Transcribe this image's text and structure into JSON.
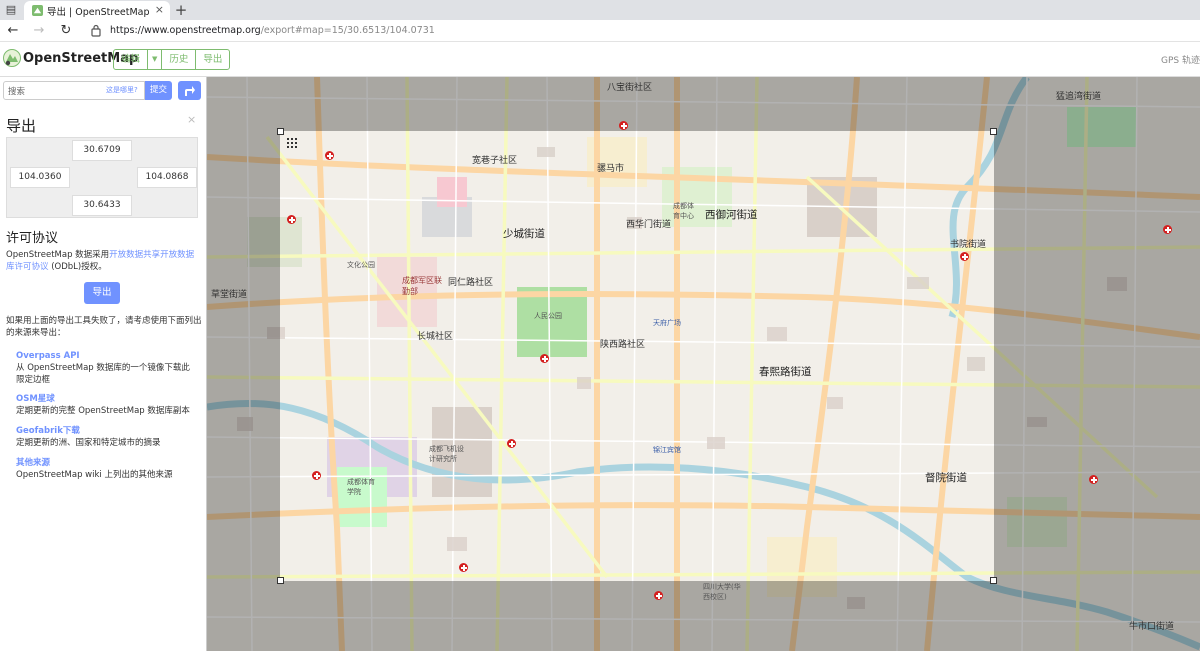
{
  "browser": {
    "tab_title": "导出 | OpenStreetMap",
    "url_host": "https://www.openstreetmap.org",
    "url_path": "/export#map=15/30.6513/104.0731"
  },
  "header": {
    "logo_text": "OpenStreetMap",
    "edit_label": "编辑",
    "history_label": "历史",
    "export_label": "导出",
    "gps_label": "GPS 轨迹"
  },
  "search": {
    "placeholder": "搜索",
    "hint": "这是哪里?",
    "submit_label": "提交"
  },
  "export_panel": {
    "title": "导出",
    "close": "×",
    "bbox": {
      "north": "30.6709",
      "west": "104.0360",
      "east": "104.0868",
      "south": "30.6433"
    },
    "license_title": "许可协议",
    "license_prefix": "OpenStreetMap 数据采用",
    "license_link": "开放数据共享开放数据库许可协议",
    "license_suffix": " (ODbL)授权。",
    "export_button": "导出",
    "fallback_text": "如果用上面的导出工具失败了，请考虑使用下面列出的来源来导出：",
    "sources": [
      {
        "title": "Overpass API",
        "desc": "从 OpenStreetMap 数据库的一个镜像下载此限定边框"
      },
      {
        "title": "OSM星球",
        "desc": "定期更新的完整 OpenStreetMap 数据库副本"
      },
      {
        "title": "Geofabrik下载",
        "desc": "定期更新的洲、国家和特定城市的摘录"
      },
      {
        "title": "其他来源",
        "desc": "OpenStreetMap wiki 上列出的其他来源"
      }
    ]
  },
  "map_labels": {
    "shaocheng": "少城街道",
    "xihuamen": "西华门街道",
    "xiyuhe": "西御河街道",
    "shuyuan": "书院街道",
    "chunxi": "春熙路街道",
    "duyuan": "督院街道",
    "caotang": "草堂街道",
    "mengzhuiwan": "猛追湾街道",
    "niushikou": "牛市口街道",
    "kuanxiang": "宽巷子社区",
    "mazhiqiao": "骡马市",
    "changcheng": "长城社区",
    "tongren": "同仁路社区",
    "shanxi": "陕西路社区",
    "bajiaojie": "八宝街社区",
    "junqu": "成都军区联勤部",
    "feiji": "成都飞机设计研究所",
    "tiyu": "成都体育学院",
    "huaxi": "四川大学(华西校区)",
    "renmin": "人民公园",
    "wenhua": "文化公园",
    "tiyuzhongxin": "成都体育中心",
    "tianfu": "天府广场",
    "jinjiang": "锦江宾馆"
  }
}
